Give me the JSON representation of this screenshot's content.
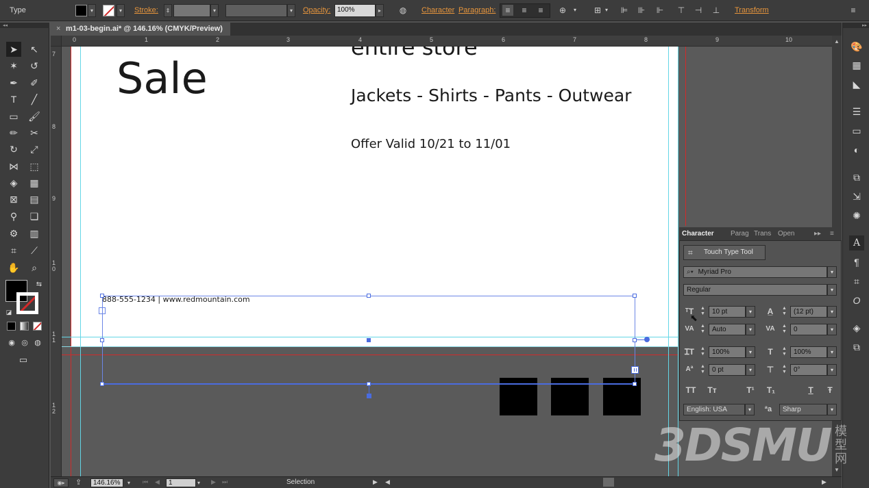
{
  "control_bar": {
    "selection_type": "Type",
    "stroke_label": "Stroke:",
    "opacity_label": "Opacity:",
    "opacity_value": "100%",
    "character_link": "Character",
    "paragraph_link": "Paragraph:",
    "transform_link": "Transform"
  },
  "document_tab": {
    "title": "m1-03-begin.ai* @ 146.16% (CMYK/Preview)",
    "close": "×"
  },
  "ruler": {
    "horizontal_ticks": [
      "0",
      "1",
      "2",
      "3",
      "4",
      "5",
      "6",
      "7",
      "8",
      "9",
      "10"
    ],
    "vertical_ticks": [
      "7",
      "8",
      "9",
      "1 0",
      "1 1",
      "1 2"
    ]
  },
  "artboard_text": {
    "sale": "Sale",
    "entire_store": "entire store",
    "categories": "Jackets - Shirts - Pants - Outwear",
    "offer": "Offer Valid 10/21 to 11/01",
    "contact": "888-555-1234 | www.redmountain.com"
  },
  "status_bar": {
    "zoom": "146.16%",
    "artboard_number": "1",
    "current_tool": "Selection"
  },
  "character_panel": {
    "tabs": [
      "Character",
      "Parag",
      "Trans",
      "Open"
    ],
    "touch_type_tool": "Touch Type Tool",
    "font_family": "Myriad Pro",
    "font_style": "Regular",
    "font_size": "10 pt",
    "leading": "(12 pt)",
    "kerning": "Auto",
    "tracking": "0",
    "vertical_scale": "100%",
    "horizontal_scale": "100%",
    "baseline_shift": "0 pt",
    "rotation": "0°",
    "style_buttons": [
      "TT",
      "Tт",
      "T¹",
      "T₁",
      "T",
      "Ŧ"
    ],
    "language": "English: USA",
    "aa_label": "ªa",
    "antialiasing": "Sharp"
  },
  "watermark": {
    "text": "3DSMU",
    "cn": "模型网"
  },
  "colors": {
    "accent_orange": "#e8963c",
    "guide_cyan": "#63d6e6",
    "bleed_red": "#d22a2a",
    "selection_blue": "#4a6ce0"
  }
}
